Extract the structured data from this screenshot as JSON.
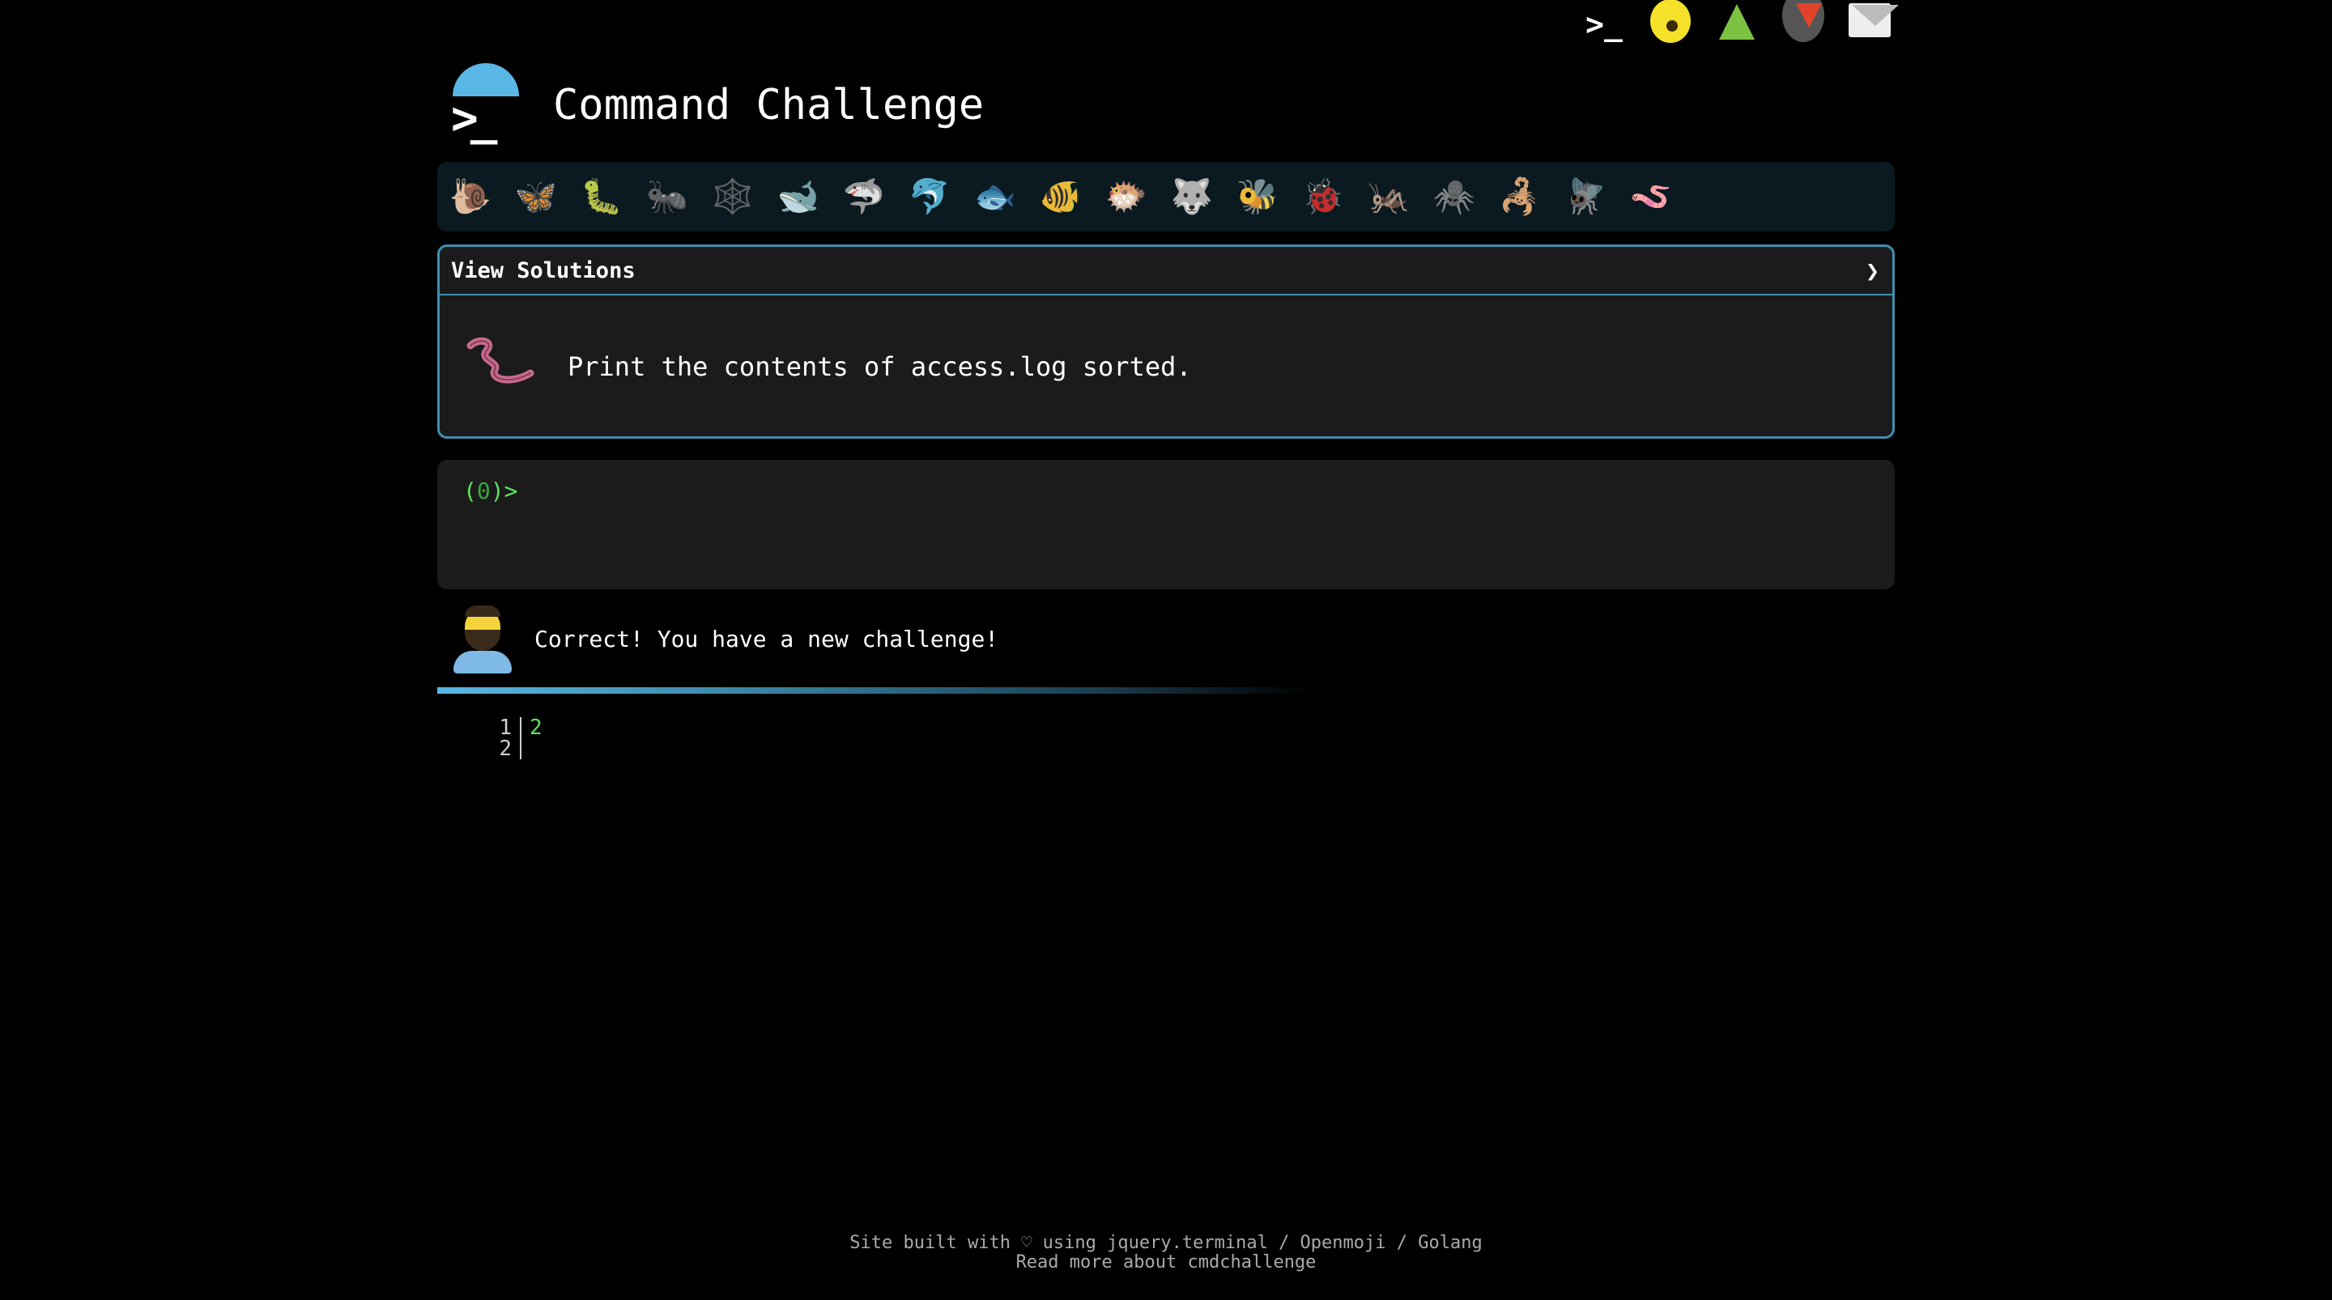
{
  "top_icons": [
    "terminal-icon",
    "shushing-face-icon",
    "tree-icon",
    "gitlab-icon",
    "mail-icon"
  ],
  "header": {
    "logo_prompt": ">_",
    "title": "Command Challenge"
  },
  "animals": [
    "🐌",
    "🦋",
    "🐛",
    "🐜",
    "🕸️",
    "🐋",
    "🦈",
    "🐬",
    "🐟",
    "🐠",
    "🐡",
    "🐺",
    "🐝",
    "🐞",
    "🦗",
    "🕷️",
    "🦂",
    "🪰",
    "🪱"
  ],
  "solutions": {
    "label": "View Solutions",
    "chevron": "❯",
    "challenge_text": "Print the contents of access.log sorted."
  },
  "terminal": {
    "prompt_open": "(",
    "prompt_count": "0",
    "prompt_close": ")>"
  },
  "feedback": {
    "message": "Correct! You have a new challenge!"
  },
  "output": {
    "rows": [
      {
        "line": "1",
        "value": "2"
      },
      {
        "line": "2",
        "value": ""
      }
    ]
  },
  "footer": {
    "line1": "Site built with ♡ using jquery.terminal / Openmoji / Golang",
    "line2": "Read more about cmdchallenge"
  },
  "colors": {
    "accent": "#5ab6e5",
    "panel_border": "#3f8fb0",
    "prompt_green": "#5fe25f",
    "panel_bg": "#1b1b1b"
  }
}
